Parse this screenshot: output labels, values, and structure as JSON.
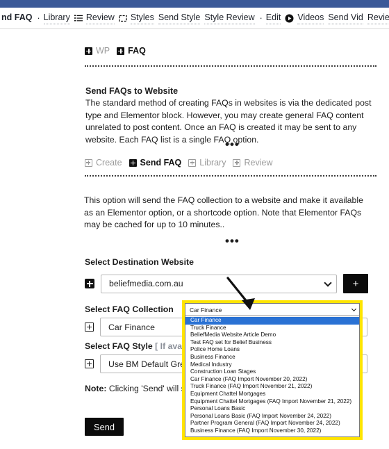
{
  "topnav": {
    "items": [
      {
        "label": "nd FAQ",
        "bold": true,
        "icon": null
      },
      {
        "label": "·",
        "separator": true
      },
      {
        "label": "Library",
        "icon": null
      },
      {
        "label": "Review",
        "icon": "list-icon"
      },
      {
        "label": "Styles",
        "icon": "square-dashed-icon"
      },
      {
        "label": "Send Style",
        "icon": null
      },
      {
        "label": "Style Review",
        "icon": null
      },
      {
        "label": "·",
        "separator": true
      },
      {
        "label": "Edit",
        "icon": null
      },
      {
        "label": "Videos",
        "icon": "play-circle-icon"
      },
      {
        "label": "Send Vid",
        "icon": null
      },
      {
        "label": "Review Vids",
        "icon": null
      }
    ]
  },
  "breadcrumb_tabs": [
    {
      "label": "WP",
      "active": false
    },
    {
      "label": "FAQ",
      "active": true
    }
  ],
  "section": {
    "heading": "Send FAQs to Website",
    "paragraph": "The standard method of creating FAQs in websites is via the dedicated post type and Elementor block. However, you may create general FAQ content unrelated to post content. Once an FAQ is created it may be sent to any website. Each FAQ list is a single FAQ option.",
    "divider_dots": "•••"
  },
  "subtabs": [
    {
      "label": "Create",
      "active": false
    },
    {
      "label": "Send FAQ",
      "active": true
    },
    {
      "label": "Library",
      "active": false
    },
    {
      "label": "Review",
      "active": false
    }
  ],
  "description": "This option will send the FAQ collection to a website and make it available as an Elementor option, or a shortcode option. Note that Elementor FAQs may be cached for up to 10 minutes..",
  "fields": {
    "destination": {
      "label": "Select Destination Website",
      "value": "beliefmedia.com.au",
      "add_button_label": "+"
    },
    "collection": {
      "label": "Select FAQ Collection",
      "value": "Car Finance"
    },
    "style": {
      "label_main": "Select FAQ Style",
      "label_soft": "[ If availab",
      "value": "Use BM Default Green"
    }
  },
  "dropdown": {
    "selected": "Car Finance",
    "options": [
      "Car Finance",
      "Truck Finance",
      "BeliefMedia Website Article Demo",
      "Test FAQ set for Belief Business",
      "Police Home Loans",
      "Business Finance",
      "Medical Industry",
      "Construction Loan Stages",
      "Car Finance (FAQ Import November 20, 2022)",
      "Truck Finance (FAQ Import November 21, 2022)",
      "Equipment Chattel Mortgages",
      "Equipment Chattel Mortgages (FAQ Import November 21, 2022)",
      "Personal Loans Basic",
      "Personal Loans Basic (FAQ Import November 24, 2022)",
      "Partner Program General (FAQ Import November 24, 2022)",
      "Business Finance (FAQ Import November 30, 2022)"
    ],
    "highlight_color": "#ffe400",
    "selection_color": "#2a72d4"
  },
  "note": {
    "prefix": "Note:",
    "text": " Clicking 'Send' will ser"
  },
  "send_button": {
    "label": "Send"
  }
}
